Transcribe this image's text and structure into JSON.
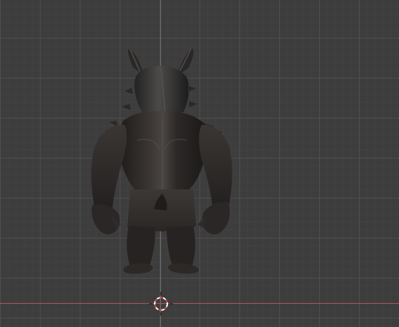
{
  "viewport": {
    "mode": "3d-viewport",
    "view": "back-orthographic",
    "colors": {
      "background": "#3d3d3d",
      "grid_major": "#505050",
      "grid_minor": "#464646",
      "x_axis": "#b0555f",
      "z_axis": "#969696",
      "cursor_red": "#e04040",
      "cursor_white": "#ffffff"
    }
  },
  "object": {
    "kind": "sculpted-creature-mesh",
    "shading": "dark-matcap"
  },
  "cursor": {
    "icon": "3d-cursor-icon"
  }
}
